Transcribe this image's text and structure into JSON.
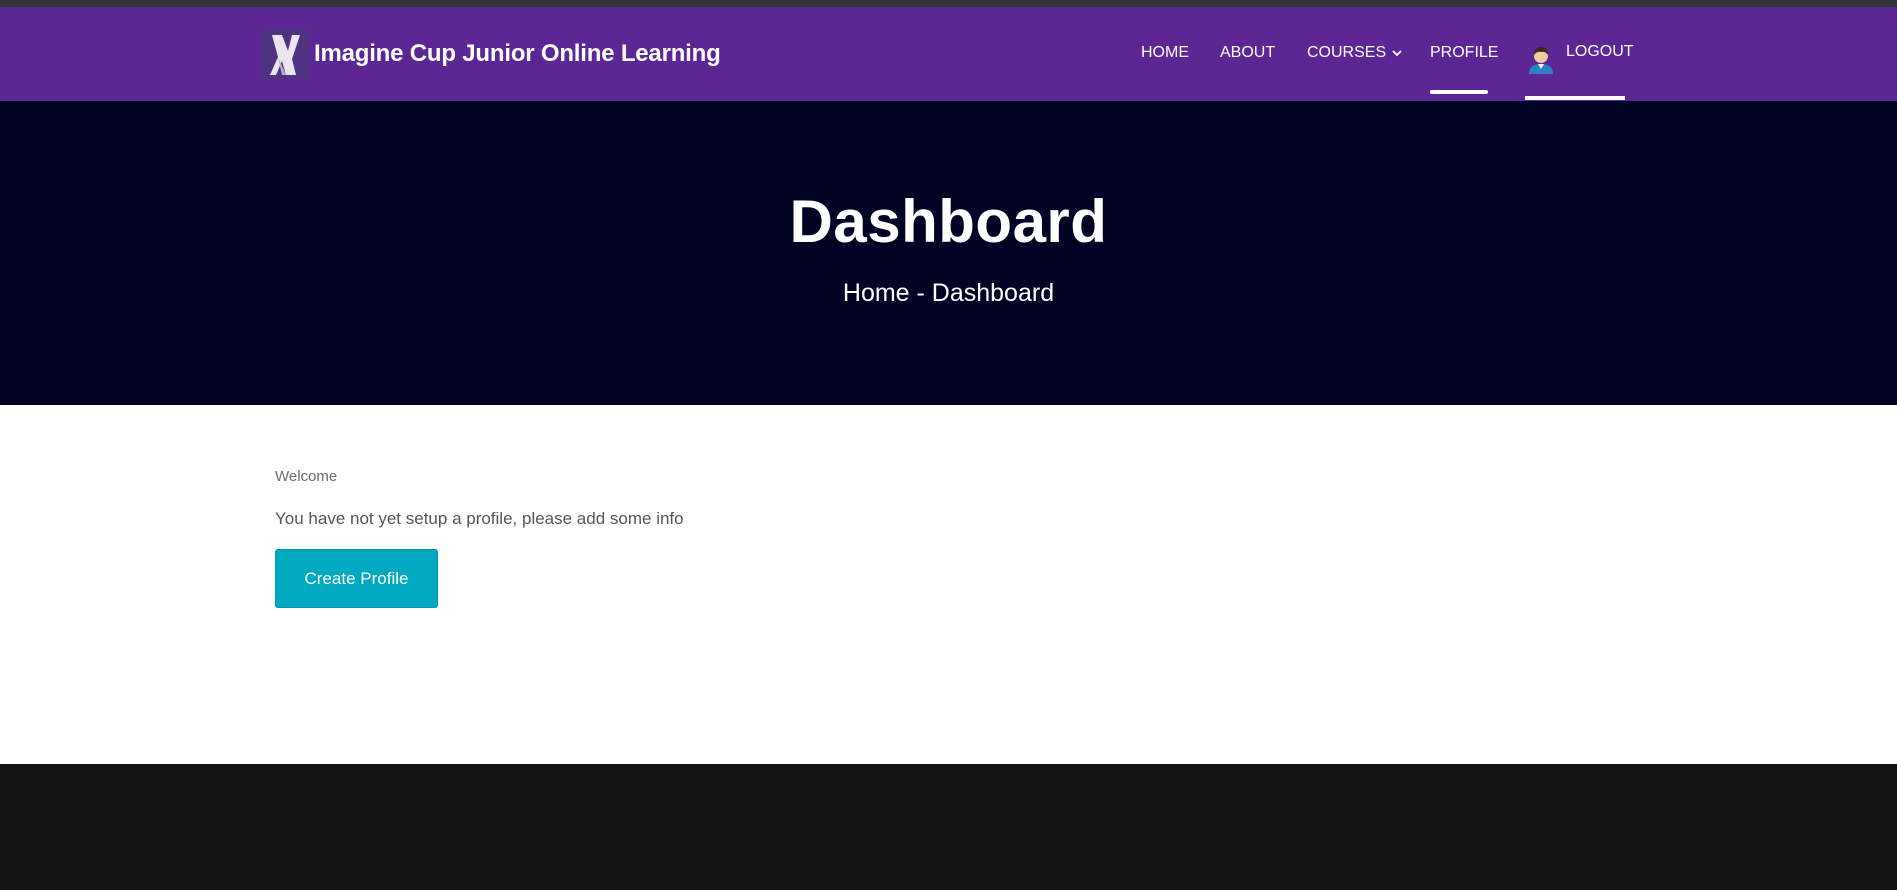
{
  "header": {
    "brand_name": "Imagine Cup Junior Online Learning",
    "nav": {
      "home": "HOME",
      "about": "ABOUT",
      "courses": "COURSES",
      "profile": "PROFILE",
      "logout": "LOGOUT"
    },
    "active_item": "PROFILE"
  },
  "hero": {
    "title": "Dashboard",
    "breadcrumb": "Home - Dashboard"
  },
  "main": {
    "welcome": "Welcome",
    "info": "You have not yet setup a profile, please add some info",
    "create_button": "Create Profile"
  },
  "colors": {
    "nav_bg": "#5c2695",
    "hero_bg": "#020224",
    "button": "#00a9c0",
    "footer_bg": "#121212"
  },
  "icons": [
    "logo-icon",
    "chevron-down-icon",
    "user-avatar-icon"
  ]
}
